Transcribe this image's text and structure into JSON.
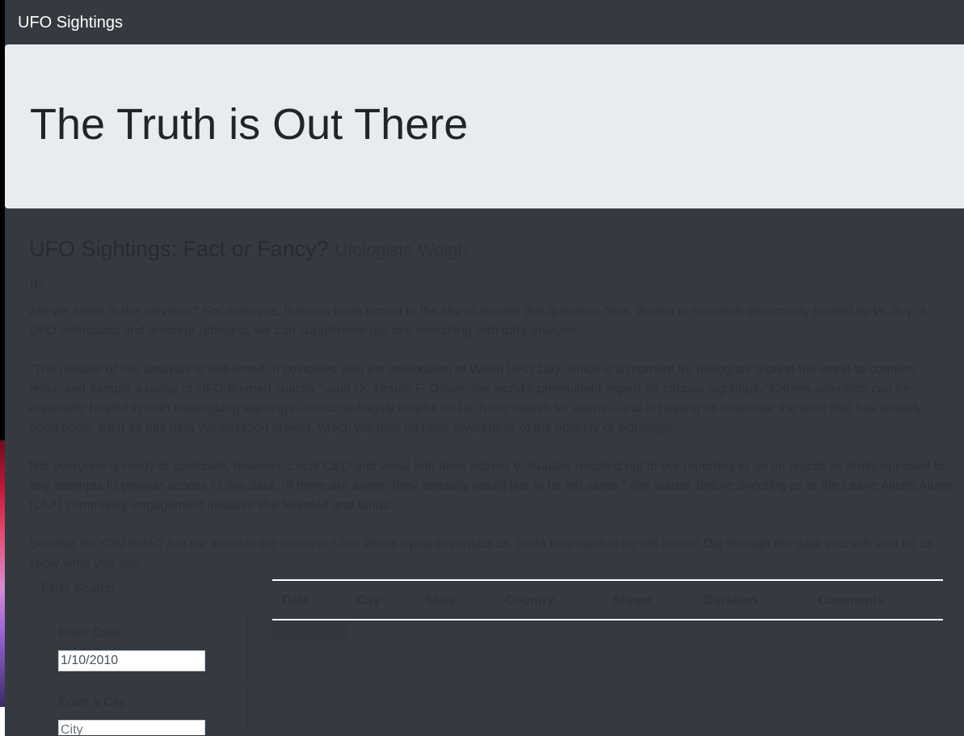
{
  "navbar": {
    "brand": "UFO Sightings"
  },
  "hero": {
    "title": "The Truth is Out There"
  },
  "article": {
    "title": "UFO Sightings: Fact or Fancy?",
    "subtitle": "Ufologists Weigh In",
    "paragraphs": [
      "Are we alone in the universe? For millennia, humans have turned to the sky to answer this question. Now, thanks to research generously funded by W. Avy, a UFO-enthusiast and amateur ufologist, we can supplement our sky-searching with data analysis.",
      "\"The release of this analysis is well-timed: It coincides with the celebration of World UFO Day, which is a moment for ufologists around the world to connect, relax, and sample a range of UFO-themed snacks,\" said Dr. Ursula F. Olivier, the world's preeminent expert on circular sightings. \"Citizen-scientists can be especially helpful in both cataloguing sightings—which is hugely helpful for us in our search for aliens—and in helping us celebrate the work that has already been done, such as this data visualization project, which will help us raise awareness of the ubiquity of sightings!\"",
      "Not everyone is ready to celebrate, however. Local CEO and vocal anti-alien activist V. Isualize reached out to our reporters to go on record as firmly opposed to any attempts to provide access to this data. \"If there are aliens, they certainly would like to be left alone,\" she stated, before directing us to the Leave Aliens Alone (LAA) community engagement initiative she founded and funds.",
      "So what do YOU think? Are we alone in the universe? Are aliens trying to contact us, or do they want to be left alone? Dig through the data yourself, and let us know what you see."
    ]
  },
  "filters": {
    "title": "Filter Search",
    "items": [
      {
        "label": "Enter Date",
        "value": "1/10/2010",
        "placeholder": ""
      },
      {
        "label": "Enter a City",
        "value": "",
        "placeholder": "City"
      }
    ]
  },
  "table": {
    "headers": [
      "Date",
      "City",
      "State",
      "Country",
      "Shape",
      "Duration",
      "Comments"
    ]
  },
  "colors": {
    "background": "#343a40",
    "jumbotron": "#e9ecef",
    "text_dark": "#212529",
    "navbar_text": "#ffffff"
  }
}
